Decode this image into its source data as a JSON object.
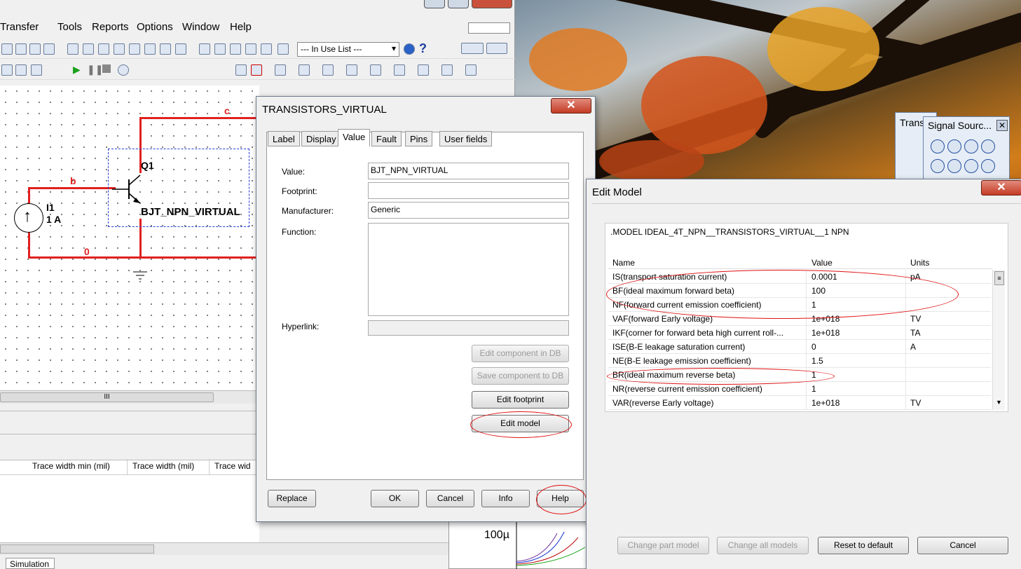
{
  "menu": [
    "Transfer",
    "Tools",
    "Reports",
    "Options",
    "Window",
    "Help"
  ],
  "toolbar": {
    "in_use_list": "--- In Use List ---"
  },
  "schematic": {
    "node_c": "c",
    "node_b": "b",
    "node_0": "0",
    "q1_label": "Q1",
    "q1_model": "BJT_NPN_VIRTUAL",
    "i1_label": "I1",
    "i1_value": "1 A"
  },
  "spreadsheet": {
    "headers": [
      "Trace width min (mil)",
      "Trace width (mil)",
      "Trace wid"
    ]
  },
  "bottom_tab": "Simulation",
  "graph_label": "100µ",
  "palettes": {
    "transistors": "Trans",
    "signal": "Signal Sourc..."
  },
  "dialog": {
    "title": "TRANSISTORS_VIRTUAL",
    "tabs": [
      "Label",
      "Display",
      "Value",
      "Fault",
      "Pins",
      "User fields"
    ],
    "active_tab": "Value",
    "fields": {
      "value_label": "Value:",
      "value": "BJT_NPN_VIRTUAL",
      "footprint_label": "Footprint:",
      "footprint": "",
      "manufacturer_label": "Manufacturer:",
      "manufacturer": "Generic",
      "function_label": "Function:",
      "function": "",
      "hyperlink_label": "Hyperlink:",
      "hyperlink": ""
    },
    "buttons": {
      "edit_component_db": "Edit component in DB",
      "save_component_db": "Save component to DB",
      "edit_footprint": "Edit footprint",
      "edit_model": "Edit model",
      "replace": "Replace",
      "ok": "OK",
      "cancel": "Cancel",
      "info": "Info",
      "help": "Help"
    }
  },
  "edit_model": {
    "title": "Edit Model",
    "model_line": ".MODEL IDEAL_4T_NPN__TRANSISTORS_VIRTUAL__1 NPN",
    "columns": [
      "Name",
      "Value",
      "Units"
    ],
    "rows": [
      {
        "name": "IS(transport saturation current)",
        "value": "0.0001",
        "units": "pA"
      },
      {
        "name": "BF(ideal maximum forward beta)",
        "value": "100",
        "units": ""
      },
      {
        "name": "NF(forward current emission coefficient)",
        "value": "1",
        "units": ""
      },
      {
        "name": "VAF(forward Early voltage)",
        "value": "1e+018",
        "units": "TV"
      },
      {
        "name": "IKF(corner for forward beta high current roll-...",
        "value": "1e+018",
        "units": "TA"
      },
      {
        "name": "ISE(B-E leakage saturation current)",
        "value": "0",
        "units": " A"
      },
      {
        "name": "NE(B-E leakage emission coefficient)",
        "value": "1.5",
        "units": ""
      },
      {
        "name": "BR(ideal maximum reverse beta)",
        "value": "1",
        "units": ""
      },
      {
        "name": "NR(reverse current emission coefficient)",
        "value": "1",
        "units": ""
      },
      {
        "name": "VAR(reverse Early voltage)",
        "value": "1e+018",
        "units": "TV"
      }
    ],
    "buttons": {
      "change_part": "Change part model",
      "change_all": "Change all models",
      "reset": "Reset to default",
      "cancel": "Cancel"
    }
  }
}
